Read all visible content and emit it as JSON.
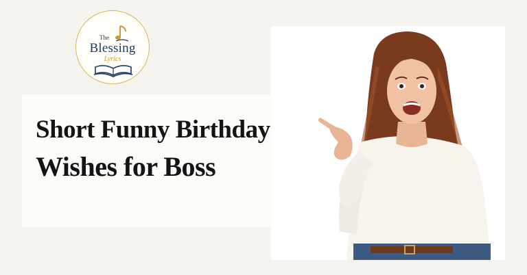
{
  "logo": {
    "the": "The",
    "main": "Blessing",
    "sub": "Lyrics"
  },
  "headline": {
    "line1": "Short Funny Birthday",
    "line2": "Wishes for Boss"
  },
  "colors": {
    "background": "#f5f3ee",
    "logo_navy": "#1f3a66",
    "logo_gold": "#c79a3c",
    "title_text": "#141414"
  }
}
